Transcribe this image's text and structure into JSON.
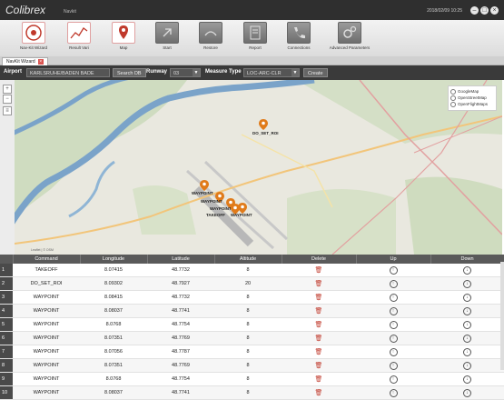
{
  "app": {
    "brand": "Colibrex",
    "brand_sub": "Navkit",
    "sysinfo": "2018/02/09 10:25"
  },
  "ribbon": [
    {
      "label": "Nav-Kit Wizard",
      "icon": "wizard-icon"
    },
    {
      "label": "Result Vari",
      "icon": "chart-icon"
    },
    {
      "label": "Map",
      "icon": "map-icon"
    },
    {
      "label": "Start",
      "icon": "start-icon"
    },
    {
      "label": "Restore",
      "icon": "restore-icon"
    },
    {
      "label": "Report",
      "icon": "report-icon"
    },
    {
      "label": "Connections",
      "icon": "phone-icon"
    },
    {
      "label": "Advanced Parameters",
      "icon": "gears-icon"
    }
  ],
  "tab": {
    "label": "NavKit Wizard"
  },
  "controls": {
    "airport_label": "Airport",
    "airport_value": "KARLSRUHE/BADEN BADE",
    "search_label": "Search DB",
    "runway_label": "Runway",
    "runway_value": "03",
    "measure_label": "Measure Type",
    "measure_value": "LOC-ARC-CLR",
    "create_label": "Create"
  },
  "map": {
    "layers": [
      "GoogleMap",
      "OpenStreetMap",
      "OpenFlightMaps"
    ],
    "markers": [
      {
        "label": "DO_SET_ROI"
      },
      {
        "label": "WAYPOINT"
      },
      {
        "label": "WAYPOINT"
      },
      {
        "label": "WAYPOINT"
      },
      {
        "label": "TAKEOFF"
      },
      {
        "label": "WAYPOINT"
      }
    ],
    "attribution": "Leaflet | © OSM"
  },
  "table": {
    "columns": [
      "Command",
      "Longitude",
      "Latitude",
      "Altitude",
      "Delete",
      "Up",
      "Down"
    ],
    "rows": [
      {
        "n": "1",
        "command": "TAKEOFF",
        "lon": "8.07415",
        "lat": "48.7732",
        "alt": "8"
      },
      {
        "n": "2",
        "command": "DO_SET_ROI",
        "lon": "8.09302",
        "lat": "48.7927",
        "alt": "20"
      },
      {
        "n": "3",
        "command": "WAYPOINT",
        "lon": "8.08415",
        "lat": "48.7732",
        "alt": "8"
      },
      {
        "n": "4",
        "command": "WAYPOINT",
        "lon": "8.08037",
        "lat": "48.7741",
        "alt": "8"
      },
      {
        "n": "5",
        "command": "WAYPOINT",
        "lon": "8.0768",
        "lat": "48.7754",
        "alt": "8"
      },
      {
        "n": "6",
        "command": "WAYPOINT",
        "lon": "8.07351",
        "lat": "48.7769",
        "alt": "8"
      },
      {
        "n": "7",
        "command": "WAYPOINT",
        "lon": "8.07056",
        "lat": "48.7787",
        "alt": "8"
      },
      {
        "n": "8",
        "command": "WAYPOINT",
        "lon": "8.07351",
        "lat": "48.7769",
        "alt": "8"
      },
      {
        "n": "9",
        "command": "WAYPOINT",
        "lon": "8.0768",
        "lat": "48.7754",
        "alt": "8"
      },
      {
        "n": "10",
        "command": "WAYPOINT",
        "lon": "8.08037",
        "lat": "48.7741",
        "alt": "8"
      }
    ]
  }
}
